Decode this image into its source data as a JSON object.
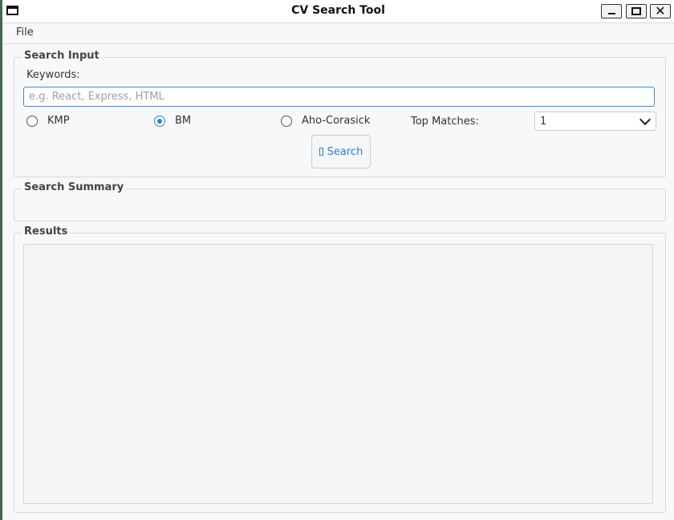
{
  "window": {
    "title": "CV Search Tool"
  },
  "menubar": {
    "items": [
      "File"
    ]
  },
  "search_input": {
    "group_title": "Search Input",
    "keywords_label": "Keywords:",
    "keywords_placeholder": "e.g. React, Express, HTML",
    "keywords_value": "",
    "algorithms": [
      {
        "label": "KMP",
        "selected": false
      },
      {
        "label": "BM",
        "selected": true
      },
      {
        "label": "Aho-Corasick",
        "selected": false
      }
    ],
    "top_matches_label": "Top Matches:",
    "top_matches_value": "1",
    "search_button_label": "Search"
  },
  "summary": {
    "group_title": "Search Summary"
  },
  "results": {
    "group_title": "Results"
  },
  "icons": {
    "app": "window-icon",
    "minimize": "minimize-icon",
    "maximize": "maximize-icon",
    "close": "close-icon",
    "dropdown": "chevron-down-icon",
    "search_button_glyph": "missing-glyph-icon"
  },
  "colors": {
    "accent": "#2f7fd4",
    "input_focus_border": "#3c8bd6"
  }
}
